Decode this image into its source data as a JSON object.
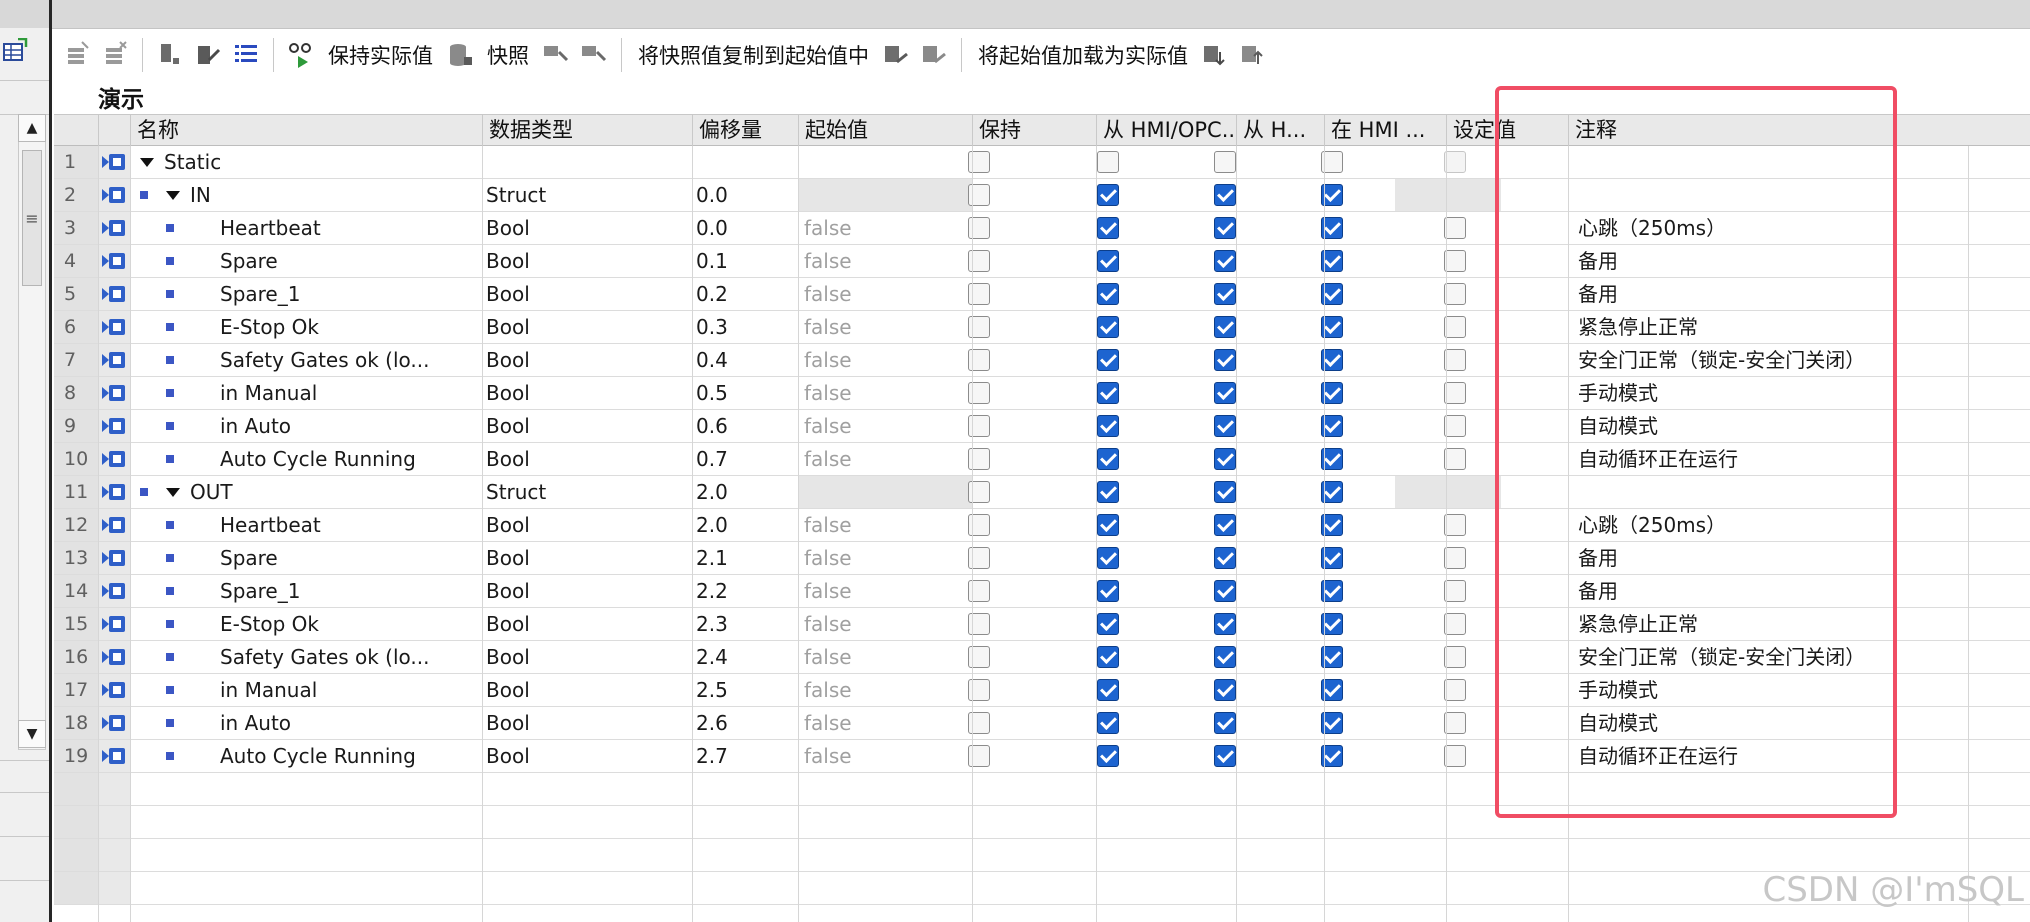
{
  "toolbar": {
    "keep_actual_values": "保持实际值",
    "snapshot": "快照",
    "copy_snapshot_to_start": "将快照值复制到起始值中",
    "load_start_as_actual": "将起始值加载为实际值"
  },
  "block_title": "演示",
  "columns": {
    "name": "名称",
    "datatype": "数据类型",
    "offset": "偏移量",
    "start_value": "起始值",
    "retain": "保持",
    "hmi_opc": "从 HMI/OPC..",
    "hmi_access": "从 H...",
    "hmi_visible": "在 HMI ...",
    "setpoint": "设定值",
    "comment": "注释"
  },
  "rows": [
    {
      "num": "1",
      "name": "Static",
      "level": 0,
      "expand": true,
      "bullet": false,
      "type": "",
      "offset": "",
      "start": "",
      "struct": false,
      "static": true,
      "retain": false,
      "c1": false,
      "c2": false,
      "c3": false,
      "setpoint": false,
      "comment": ""
    },
    {
      "num": "2",
      "name": "IN",
      "level": 1,
      "expand": true,
      "bullet": true,
      "type": "Struct",
      "offset": "0.0",
      "start": "",
      "struct": true,
      "static": false,
      "retain": false,
      "c1": true,
      "c2": true,
      "c3": true,
      "setpoint": false,
      "comment": ""
    },
    {
      "num": "3",
      "name": "Heartbeat",
      "level": 2,
      "expand": false,
      "bullet": true,
      "type": "Bool",
      "offset": "0.0",
      "start": "false",
      "struct": false,
      "static": false,
      "retain": false,
      "c1": true,
      "c2": true,
      "c3": true,
      "setpoint": false,
      "comment": "心跳（250ms）"
    },
    {
      "num": "4",
      "name": "Spare",
      "level": 2,
      "expand": false,
      "bullet": true,
      "type": "Bool",
      "offset": "0.1",
      "start": "false",
      "struct": false,
      "static": false,
      "retain": false,
      "c1": true,
      "c2": true,
      "c3": true,
      "setpoint": false,
      "comment": "备用"
    },
    {
      "num": "5",
      "name": "Spare_1",
      "level": 2,
      "expand": false,
      "bullet": true,
      "type": "Bool",
      "offset": "0.2",
      "start": "false",
      "struct": false,
      "static": false,
      "retain": false,
      "c1": true,
      "c2": true,
      "c3": true,
      "setpoint": false,
      "comment": "备用"
    },
    {
      "num": "6",
      "name": "E-Stop Ok",
      "level": 2,
      "expand": false,
      "bullet": true,
      "type": "Bool",
      "offset": "0.3",
      "start": "false",
      "struct": false,
      "static": false,
      "retain": false,
      "c1": true,
      "c2": true,
      "c3": true,
      "setpoint": false,
      "comment": "紧急停止正常"
    },
    {
      "num": "7",
      "name": "Safety Gates ok (lo...",
      "level": 2,
      "expand": false,
      "bullet": true,
      "type": "Bool",
      "offset": "0.4",
      "start": "false",
      "struct": false,
      "static": false,
      "retain": false,
      "c1": true,
      "c2": true,
      "c3": true,
      "setpoint": false,
      "comment": "安全门正常（锁定-安全门关闭）"
    },
    {
      "num": "8",
      "name": "in Manual",
      "level": 2,
      "expand": false,
      "bullet": true,
      "type": "Bool",
      "offset": "0.5",
      "start": "false",
      "struct": false,
      "static": false,
      "retain": false,
      "c1": true,
      "c2": true,
      "c3": true,
      "setpoint": false,
      "comment": "手动模式"
    },
    {
      "num": "9",
      "name": "in Auto",
      "level": 2,
      "expand": false,
      "bullet": true,
      "type": "Bool",
      "offset": "0.6",
      "start": "false",
      "struct": false,
      "static": false,
      "retain": false,
      "c1": true,
      "c2": true,
      "c3": true,
      "setpoint": false,
      "comment": "自动模式"
    },
    {
      "num": "10",
      "name": "Auto Cycle Running",
      "level": 2,
      "expand": false,
      "bullet": true,
      "type": "Bool",
      "offset": "0.7",
      "start": "false",
      "struct": false,
      "static": false,
      "retain": false,
      "c1": true,
      "c2": true,
      "c3": true,
      "setpoint": false,
      "comment": "自动循环正在运行"
    },
    {
      "num": "11",
      "name": "OUT",
      "level": 1,
      "expand": true,
      "bullet": true,
      "type": "Struct",
      "offset": "2.0",
      "start": "",
      "struct": true,
      "static": false,
      "retain": false,
      "c1": true,
      "c2": true,
      "c3": true,
      "setpoint": false,
      "comment": ""
    },
    {
      "num": "12",
      "name": "Heartbeat",
      "level": 2,
      "expand": false,
      "bullet": true,
      "type": "Bool",
      "offset": "2.0",
      "start": "false",
      "struct": false,
      "static": false,
      "retain": false,
      "c1": true,
      "c2": true,
      "c3": true,
      "setpoint": false,
      "comment": "心跳（250ms）"
    },
    {
      "num": "13",
      "name": "Spare",
      "level": 2,
      "expand": false,
      "bullet": true,
      "type": "Bool",
      "offset": "2.1",
      "start": "false",
      "struct": false,
      "static": false,
      "retain": false,
      "c1": true,
      "c2": true,
      "c3": true,
      "setpoint": false,
      "comment": "备用"
    },
    {
      "num": "14",
      "name": "Spare_1",
      "level": 2,
      "expand": false,
      "bullet": true,
      "type": "Bool",
      "offset": "2.2",
      "start": "false",
      "struct": false,
      "static": false,
      "retain": false,
      "c1": true,
      "c2": true,
      "c3": true,
      "setpoint": false,
      "comment": "备用"
    },
    {
      "num": "15",
      "name": "E-Stop Ok",
      "level": 2,
      "expand": false,
      "bullet": true,
      "type": "Bool",
      "offset": "2.3",
      "start": "false",
      "struct": false,
      "static": false,
      "retain": false,
      "c1": true,
      "c2": true,
      "c3": true,
      "setpoint": false,
      "comment": "紧急停止正常"
    },
    {
      "num": "16",
      "name": "Safety Gates ok (lo...",
      "level": 2,
      "expand": false,
      "bullet": true,
      "type": "Bool",
      "offset": "2.4",
      "start": "false",
      "struct": false,
      "static": false,
      "retain": false,
      "c1": true,
      "c2": true,
      "c3": true,
      "setpoint": false,
      "comment": "安全门正常（锁定-安全门关闭）"
    },
    {
      "num": "17",
      "name": "in Manual",
      "level": 2,
      "expand": false,
      "bullet": true,
      "type": "Bool",
      "offset": "2.5",
      "start": "false",
      "struct": false,
      "static": false,
      "retain": false,
      "c1": true,
      "c2": true,
      "c3": true,
      "setpoint": false,
      "comment": "手动模式"
    },
    {
      "num": "18",
      "name": "in Auto",
      "level": 2,
      "expand": false,
      "bullet": true,
      "type": "Bool",
      "offset": "2.6",
      "start": "false",
      "struct": false,
      "static": false,
      "retain": false,
      "c1": true,
      "c2": true,
      "c3": true,
      "setpoint": false,
      "comment": "自动模式"
    },
    {
      "num": "19",
      "name": "Auto Cycle Running",
      "level": 2,
      "expand": false,
      "bullet": true,
      "type": "Bool",
      "offset": "2.7",
      "start": "false",
      "struct": false,
      "static": false,
      "retain": false,
      "c1": true,
      "c2": true,
      "c3": true,
      "setpoint": false,
      "comment": "自动循环正在运行"
    }
  ],
  "watermark": "CSDN @I'mSQL",
  "colors": {
    "accent": "#1d64d0",
    "highlight": "#f04d64",
    "bullet": "#3b56c4"
  }
}
